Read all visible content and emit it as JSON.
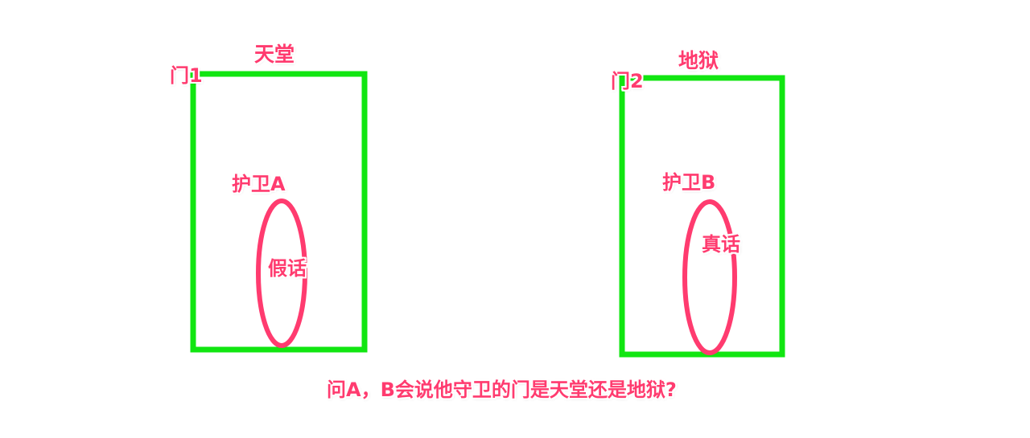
{
  "colors": {
    "frame_stroke": "#11e611",
    "ellipse_stroke": "#ff3b6f",
    "label_text": "#ff3b6f"
  },
  "door1": {
    "door_label": "门1",
    "place_label": "天堂",
    "guard_label": "护卫A",
    "speech_label": "假话"
  },
  "door2": {
    "door_label": "门2",
    "place_label": "地狱",
    "guard_label": "护卫B",
    "speech_label": "真话"
  },
  "question": "问A，B会说他守卫的门是天堂还是地狱?"
}
